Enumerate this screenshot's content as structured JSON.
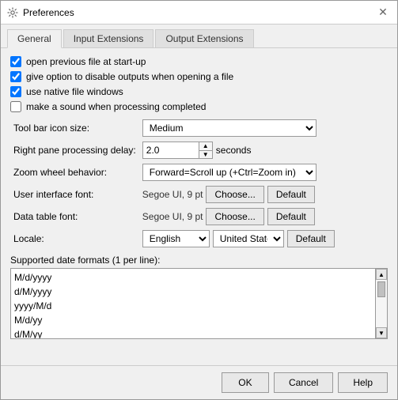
{
  "window": {
    "title": "Preferences",
    "close_label": "✕"
  },
  "tabs": [
    {
      "label": "General",
      "active": true
    },
    {
      "label": "Input Extensions",
      "active": false
    },
    {
      "label": "Output Extensions",
      "active": false
    }
  ],
  "checkboxes": [
    {
      "id": "cb1",
      "label": "open previous file at start-up",
      "checked": true
    },
    {
      "id": "cb2",
      "label": "give option to disable outputs when opening a file",
      "checked": true
    },
    {
      "id": "cb3",
      "label": "use native file windows",
      "checked": true
    },
    {
      "id": "cb4",
      "label": "make a sound when processing completed",
      "checked": false
    }
  ],
  "form": {
    "toolbar_icon_size_label": "Tool bar icon size:",
    "toolbar_icon_size_value": "Medium",
    "processing_delay_label": "Right pane processing delay:",
    "processing_delay_value": "2.0",
    "processing_delay_unit": "seconds",
    "zoom_behavior_label": "Zoom wheel behavior:",
    "zoom_behavior_value": "Forward=Scroll up (+Ctrl=Zoom in)",
    "ui_font_label": "User interface font:",
    "ui_font_value": "Segoe UI, 9 pt",
    "data_font_label": "Data table font:",
    "data_font_value": "Segoe UI, 9 pt",
    "locale_label": "Locale:",
    "locale_language": "English",
    "locale_region": "United State",
    "choose_label": "Choose...",
    "default_label": "Default"
  },
  "date_formats": {
    "label": "Supported date formats (1 per line):",
    "lines": [
      "M/d/yyyy",
      "d/M/yyyy",
      "yyyy/M/d",
      "M/d/yy",
      "d/M/yy"
    ]
  },
  "footer": {
    "ok_label": "OK",
    "cancel_label": "Cancel",
    "help_label": "Help"
  }
}
